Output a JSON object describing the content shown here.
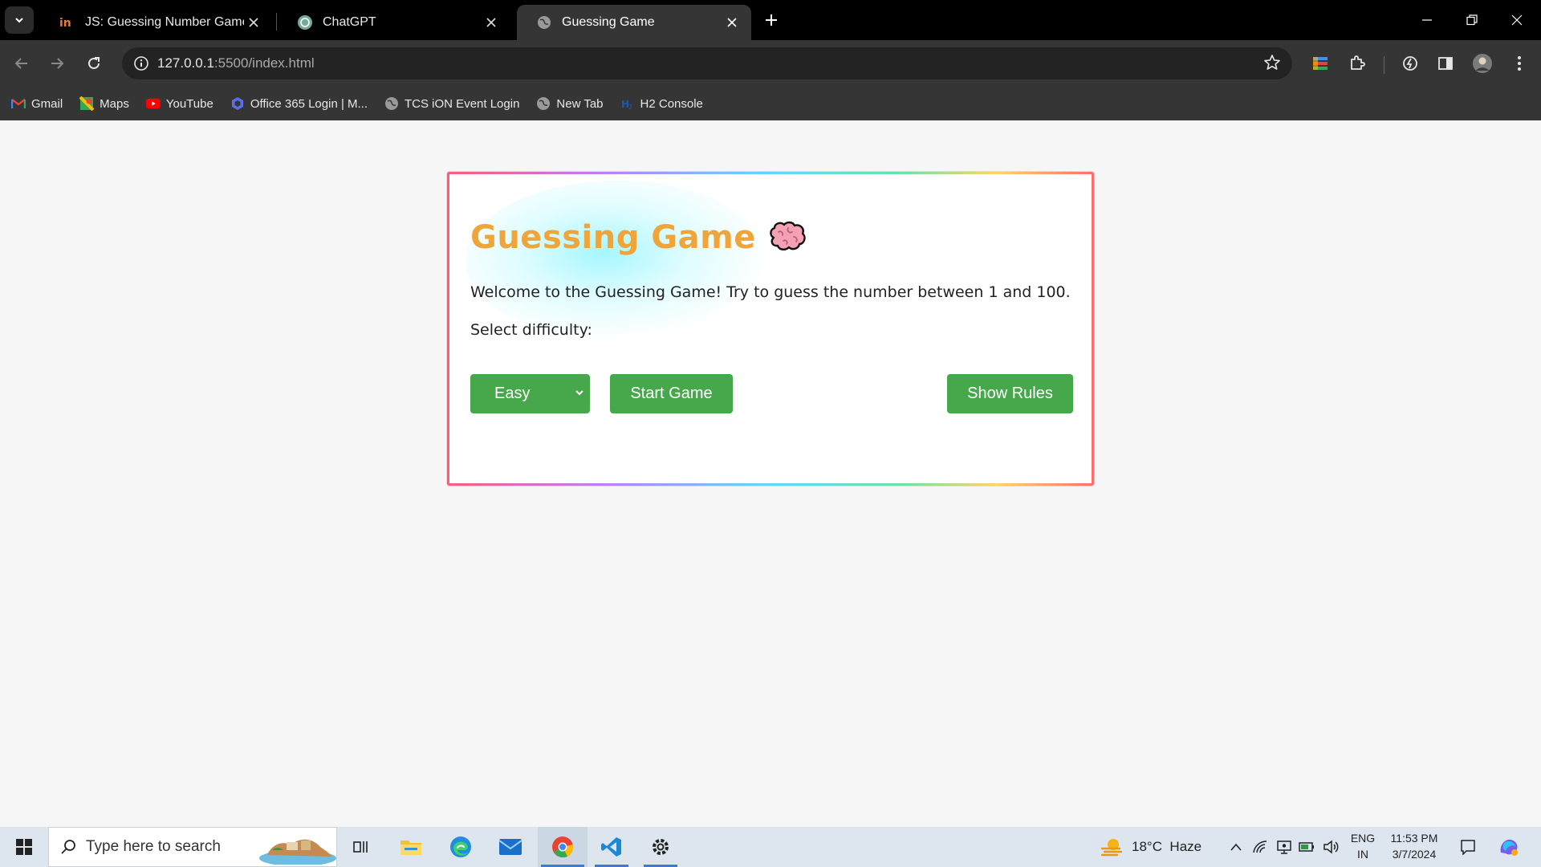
{
  "browser": {
    "tabs": [
      {
        "title": "JS: Guessing Number Game Ass",
        "favicon": "in-logo-icon",
        "active": false
      },
      {
        "title": "ChatGPT",
        "favicon": "chatgpt-icon",
        "active": false
      },
      {
        "title": "Guessing Game",
        "favicon": "globe-icon",
        "active": true
      }
    ],
    "url": {
      "host": "127.0.0.1",
      "path": ":5500/index.html"
    },
    "bookmarks": [
      {
        "label": "Gmail",
        "icon": "gmail-icon"
      },
      {
        "label": "Maps",
        "icon": "maps-icon"
      },
      {
        "label": "YouTube",
        "icon": "youtube-icon"
      },
      {
        "label": "Office 365 Login | M...",
        "icon": "office-icon"
      },
      {
        "label": "TCS iON Event Login",
        "icon": "globe-icon"
      },
      {
        "label": "New Tab",
        "icon": "globe-icon"
      },
      {
        "label": "H2 Console",
        "icon": "h2-icon"
      }
    ]
  },
  "game": {
    "title": "Guessing Game",
    "emoji_icon": "brain-icon",
    "welcome": "Welcome to the Guessing Game! Try to guess the number between 1 and 100.",
    "difficulty_label": "Select difficulty:",
    "difficulty_selected": "Easy",
    "start_label": "Start Game",
    "rules_label": "Show Rules"
  },
  "taskbar": {
    "search_placeholder": "Type here to search",
    "weather": "18°C  Haze",
    "language": "ENG",
    "region": "IN",
    "time": "11:53 PM",
    "date": "3/7/2024"
  },
  "colors": {
    "title_orange": "#f0a53a",
    "button_green": "#47a84b",
    "page_bg": "#f6f6f6"
  }
}
